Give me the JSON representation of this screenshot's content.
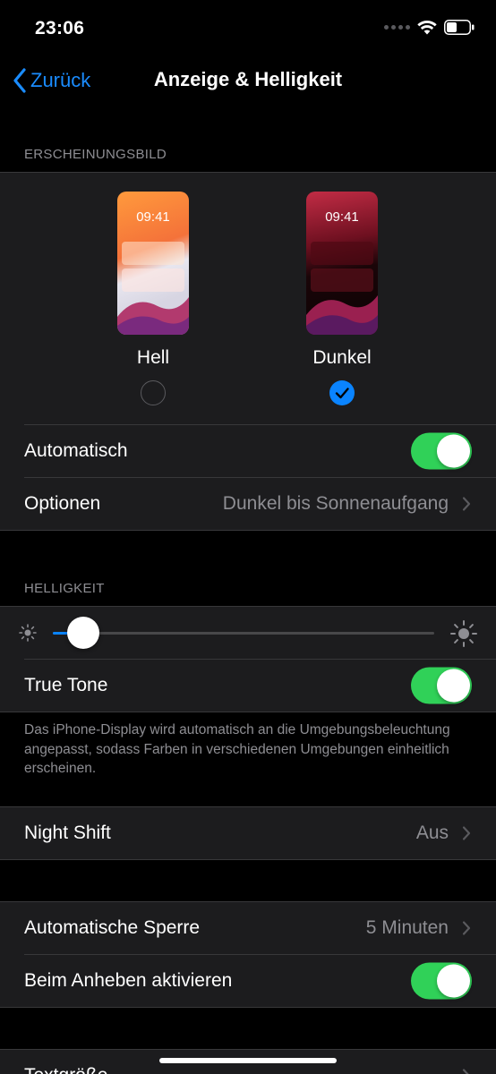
{
  "status": {
    "time": "23:06"
  },
  "nav": {
    "back_label": "Zurück",
    "title": "Anzeige & Helligkeit"
  },
  "appearance": {
    "header": "ERSCHEINUNGSBILD",
    "options": [
      {
        "label": "Hell",
        "preview_time": "09:41",
        "selected": false
      },
      {
        "label": "Dunkel",
        "preview_time": "09:41",
        "selected": true
      }
    ],
    "automatic": {
      "label": "Automatisch",
      "enabled": true
    },
    "options_row": {
      "label": "Optionen",
      "value": "Dunkel bis Sonnenaufgang"
    }
  },
  "brightness": {
    "header": "HELLIGKEIT",
    "level": 0.08,
    "true_tone": {
      "label": "True Tone",
      "enabled": true
    },
    "footer": "Das iPhone-Display wird automatisch an die Umgebungsbeleuchtung angepasst, sodass Farben in verschiedenen Umgebungen einheitlich erscheinen."
  },
  "night_shift": {
    "label": "Night Shift",
    "value": "Aus"
  },
  "lock": {
    "auto_lock": {
      "label": "Automatische Sperre",
      "value": "5 Minuten"
    },
    "raise_to_wake": {
      "label": "Beim Anheben aktivieren",
      "enabled": true
    }
  },
  "text_size": {
    "label": "Textgröße"
  },
  "colors": {
    "accent": "#0a84ff",
    "toggle_on": "#30d158",
    "group_bg": "#1c1c1e"
  }
}
